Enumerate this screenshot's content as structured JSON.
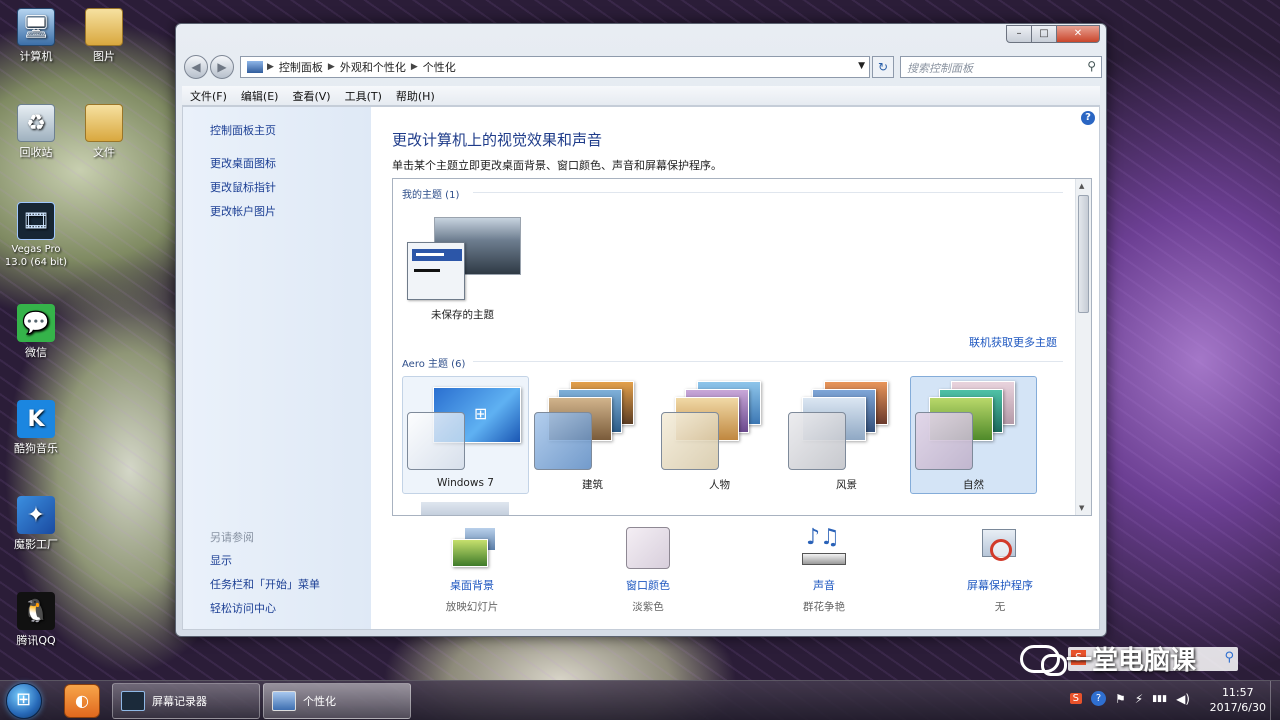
{
  "desktop": {
    "icons": [
      {
        "label": "计算机",
        "icon": "computer-icon"
      },
      {
        "label": "图片",
        "icon": "folder-icon"
      },
      {
        "label": "回收站",
        "icon": "recycle-bin-icon"
      },
      {
        "label": "文件",
        "icon": "folder-icon"
      },
      {
        "label": "Vegas Pro 13.0 (64 bit)",
        "icon": "vegas-icon"
      },
      {
        "label": "微信",
        "icon": "wechat-icon"
      },
      {
        "label": "酷狗音乐",
        "icon": "kugou-icon"
      },
      {
        "label": "魔影工厂",
        "icon": "magic-factory-icon"
      },
      {
        "label": "腾讯QQ",
        "icon": "qq-icon"
      }
    ]
  },
  "window": {
    "caption": {
      "minimize": "–",
      "maximize": "□",
      "close": "✕"
    },
    "nav": {
      "back": "◀",
      "forward": "▶"
    },
    "address": {
      "crumbs": [
        "控制面板",
        "外观和个性化",
        "个性化"
      ],
      "separator": "▶",
      "dropdown": "▼"
    },
    "refresh": "↻",
    "search": {
      "placeholder": "搜索控制面板",
      "icon": "⚲"
    },
    "menu": [
      "文件(F)",
      "编辑(E)",
      "查看(V)",
      "工具(T)",
      "帮助(H)"
    ],
    "left_pane": {
      "home": "控制面板主页",
      "links": [
        "更改桌面图标",
        "更改鼠标指针",
        "更改帐户图片"
      ],
      "see_also_heading": "另请参阅",
      "see_also": [
        "显示",
        "任务栏和「开始」菜单",
        "轻松访问中心"
      ]
    },
    "main": {
      "help": "?",
      "title": "更改计算机上的视觉效果和声音",
      "description": "单击某个主题立即更改桌面背景、窗口颜色、声音和屏幕保护程序。",
      "my_themes_heading": "我的主题 (1)",
      "unsaved_theme": "未保存的主题",
      "online_link": "联机获取更多主题",
      "aero_heading": "Aero 主题 (6)",
      "aero_themes": [
        "Windows 7",
        "建筑",
        "人物",
        "风景",
        "自然"
      ],
      "scroll_up": "▲",
      "scroll_down": "▼"
    },
    "bottom": [
      {
        "link": "桌面背景",
        "sub": "放映幻灯片"
      },
      {
        "link": "窗口颜色",
        "sub": "淡紫色"
      },
      {
        "link": "声音",
        "sub": "群花争艳"
      },
      {
        "link": "屏幕保护程序",
        "sub": "无"
      }
    ]
  },
  "taskbar": {
    "tasks": [
      "屏幕记录器",
      "个性化"
    ],
    "tray": {
      "ime": "S",
      "help": "?",
      "flag": "⚑",
      "power": "⚡",
      "signal": "▮▮▮",
      "volume": "◀)"
    },
    "time": "11:57",
    "date": "2017/6/30"
  },
  "watermark": {
    "text": "一堂电脑课"
  },
  "colors": {
    "link": "#1f58c0",
    "title": "#1f3c8a",
    "selected_tile": "#d4e4f6"
  }
}
